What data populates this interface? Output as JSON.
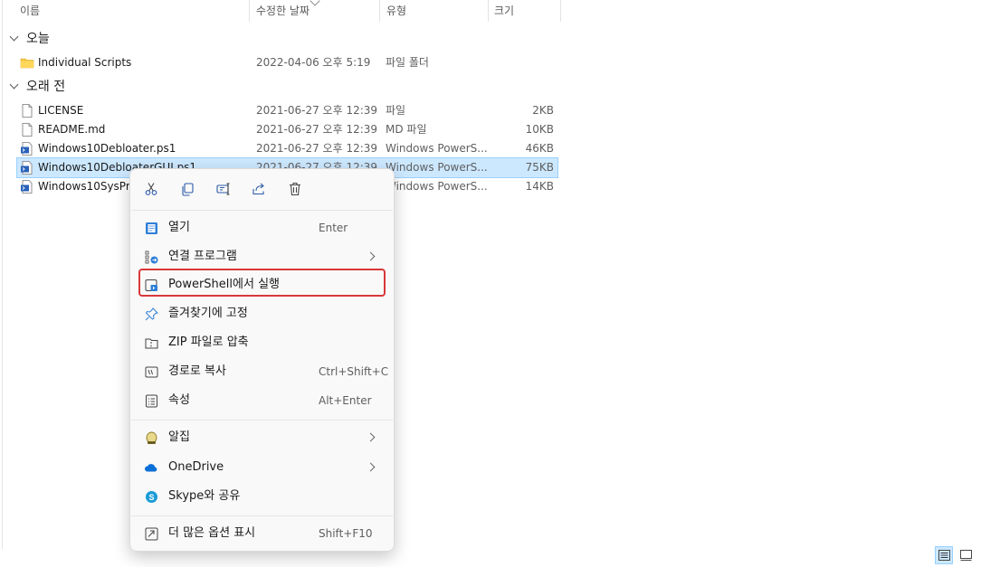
{
  "columns": {
    "name": "이름",
    "date": "수정한 날짜",
    "type": "유형",
    "size": "크기"
  },
  "groups": {
    "today": "오늘",
    "older": "오래 전"
  },
  "files": [
    {
      "name": "Individual Scripts",
      "date": "2022-04-06 오후 5:19",
      "type": "파일 폴더",
      "size": "",
      "icon": "folder-icon"
    },
    {
      "name": "LICENSE",
      "date": "2021-06-27 오후 12:39",
      "type": "파일",
      "size": "2KB",
      "icon": "file-icon"
    },
    {
      "name": "README.md",
      "date": "2021-06-27 오후 12:39",
      "type": "MD 파일",
      "size": "10KB",
      "icon": "file-icon"
    },
    {
      "name": "Windows10Debloater.ps1",
      "date": "2021-06-27 오후 12:39",
      "type": "Windows PowerS...",
      "size": "46KB",
      "icon": "powershell-script-icon"
    },
    {
      "name": "Windows10DebloaterGUI.ps1",
      "date": "2021-06-27 오후 12:39",
      "type": "Windows PowerS...",
      "size": "75KB",
      "icon": "powershell-script-icon"
    },
    {
      "name": "Windows10SysPrep",
      "date": "",
      "type": "Windows PowerS...",
      "size": "14KB",
      "icon": "powershell-script-icon"
    }
  ],
  "context_menu": {
    "toolbar": [
      "cut-icon",
      "copy-icon",
      "rename-icon",
      "share-icon",
      "delete-icon"
    ],
    "items": [
      {
        "label": "열기",
        "shortcut": "Enter",
        "icon": "open-icon"
      },
      {
        "label": "연결 프로그램",
        "shortcut": "",
        "icon": "open-with-icon",
        "submenu": true
      },
      {
        "label": "PowerShell에서 실행",
        "shortcut": "",
        "icon": "powershell-run-icon",
        "highlighted": true
      },
      {
        "label": "즐겨찾기에 고정",
        "shortcut": "",
        "icon": "pin-icon"
      },
      {
        "label": "ZIP 파일로 압축",
        "shortcut": "",
        "icon": "zip-icon"
      },
      {
        "label": "경로로 복사",
        "shortcut": "Ctrl+Shift+C",
        "icon": "copy-path-icon"
      },
      {
        "label": "속성",
        "shortcut": "Alt+Enter",
        "icon": "properties-icon"
      },
      {
        "label": "알집",
        "shortcut": "",
        "icon": "alzip-icon",
        "submenu": true
      },
      {
        "label": "OneDrive",
        "shortcut": "",
        "icon": "onedrive-icon",
        "submenu": true
      },
      {
        "label": "Skype와 공유",
        "shortcut": "",
        "icon": "skype-icon"
      },
      {
        "label": "더 많은 옵션 표시",
        "shortcut": "Shift+F10",
        "icon": "more-options-icon"
      }
    ]
  },
  "colors": {
    "selection": "#cce8ff",
    "highlight_border": "#d9383a",
    "folder": "#f6c744",
    "accent": "#0a6fd6"
  }
}
